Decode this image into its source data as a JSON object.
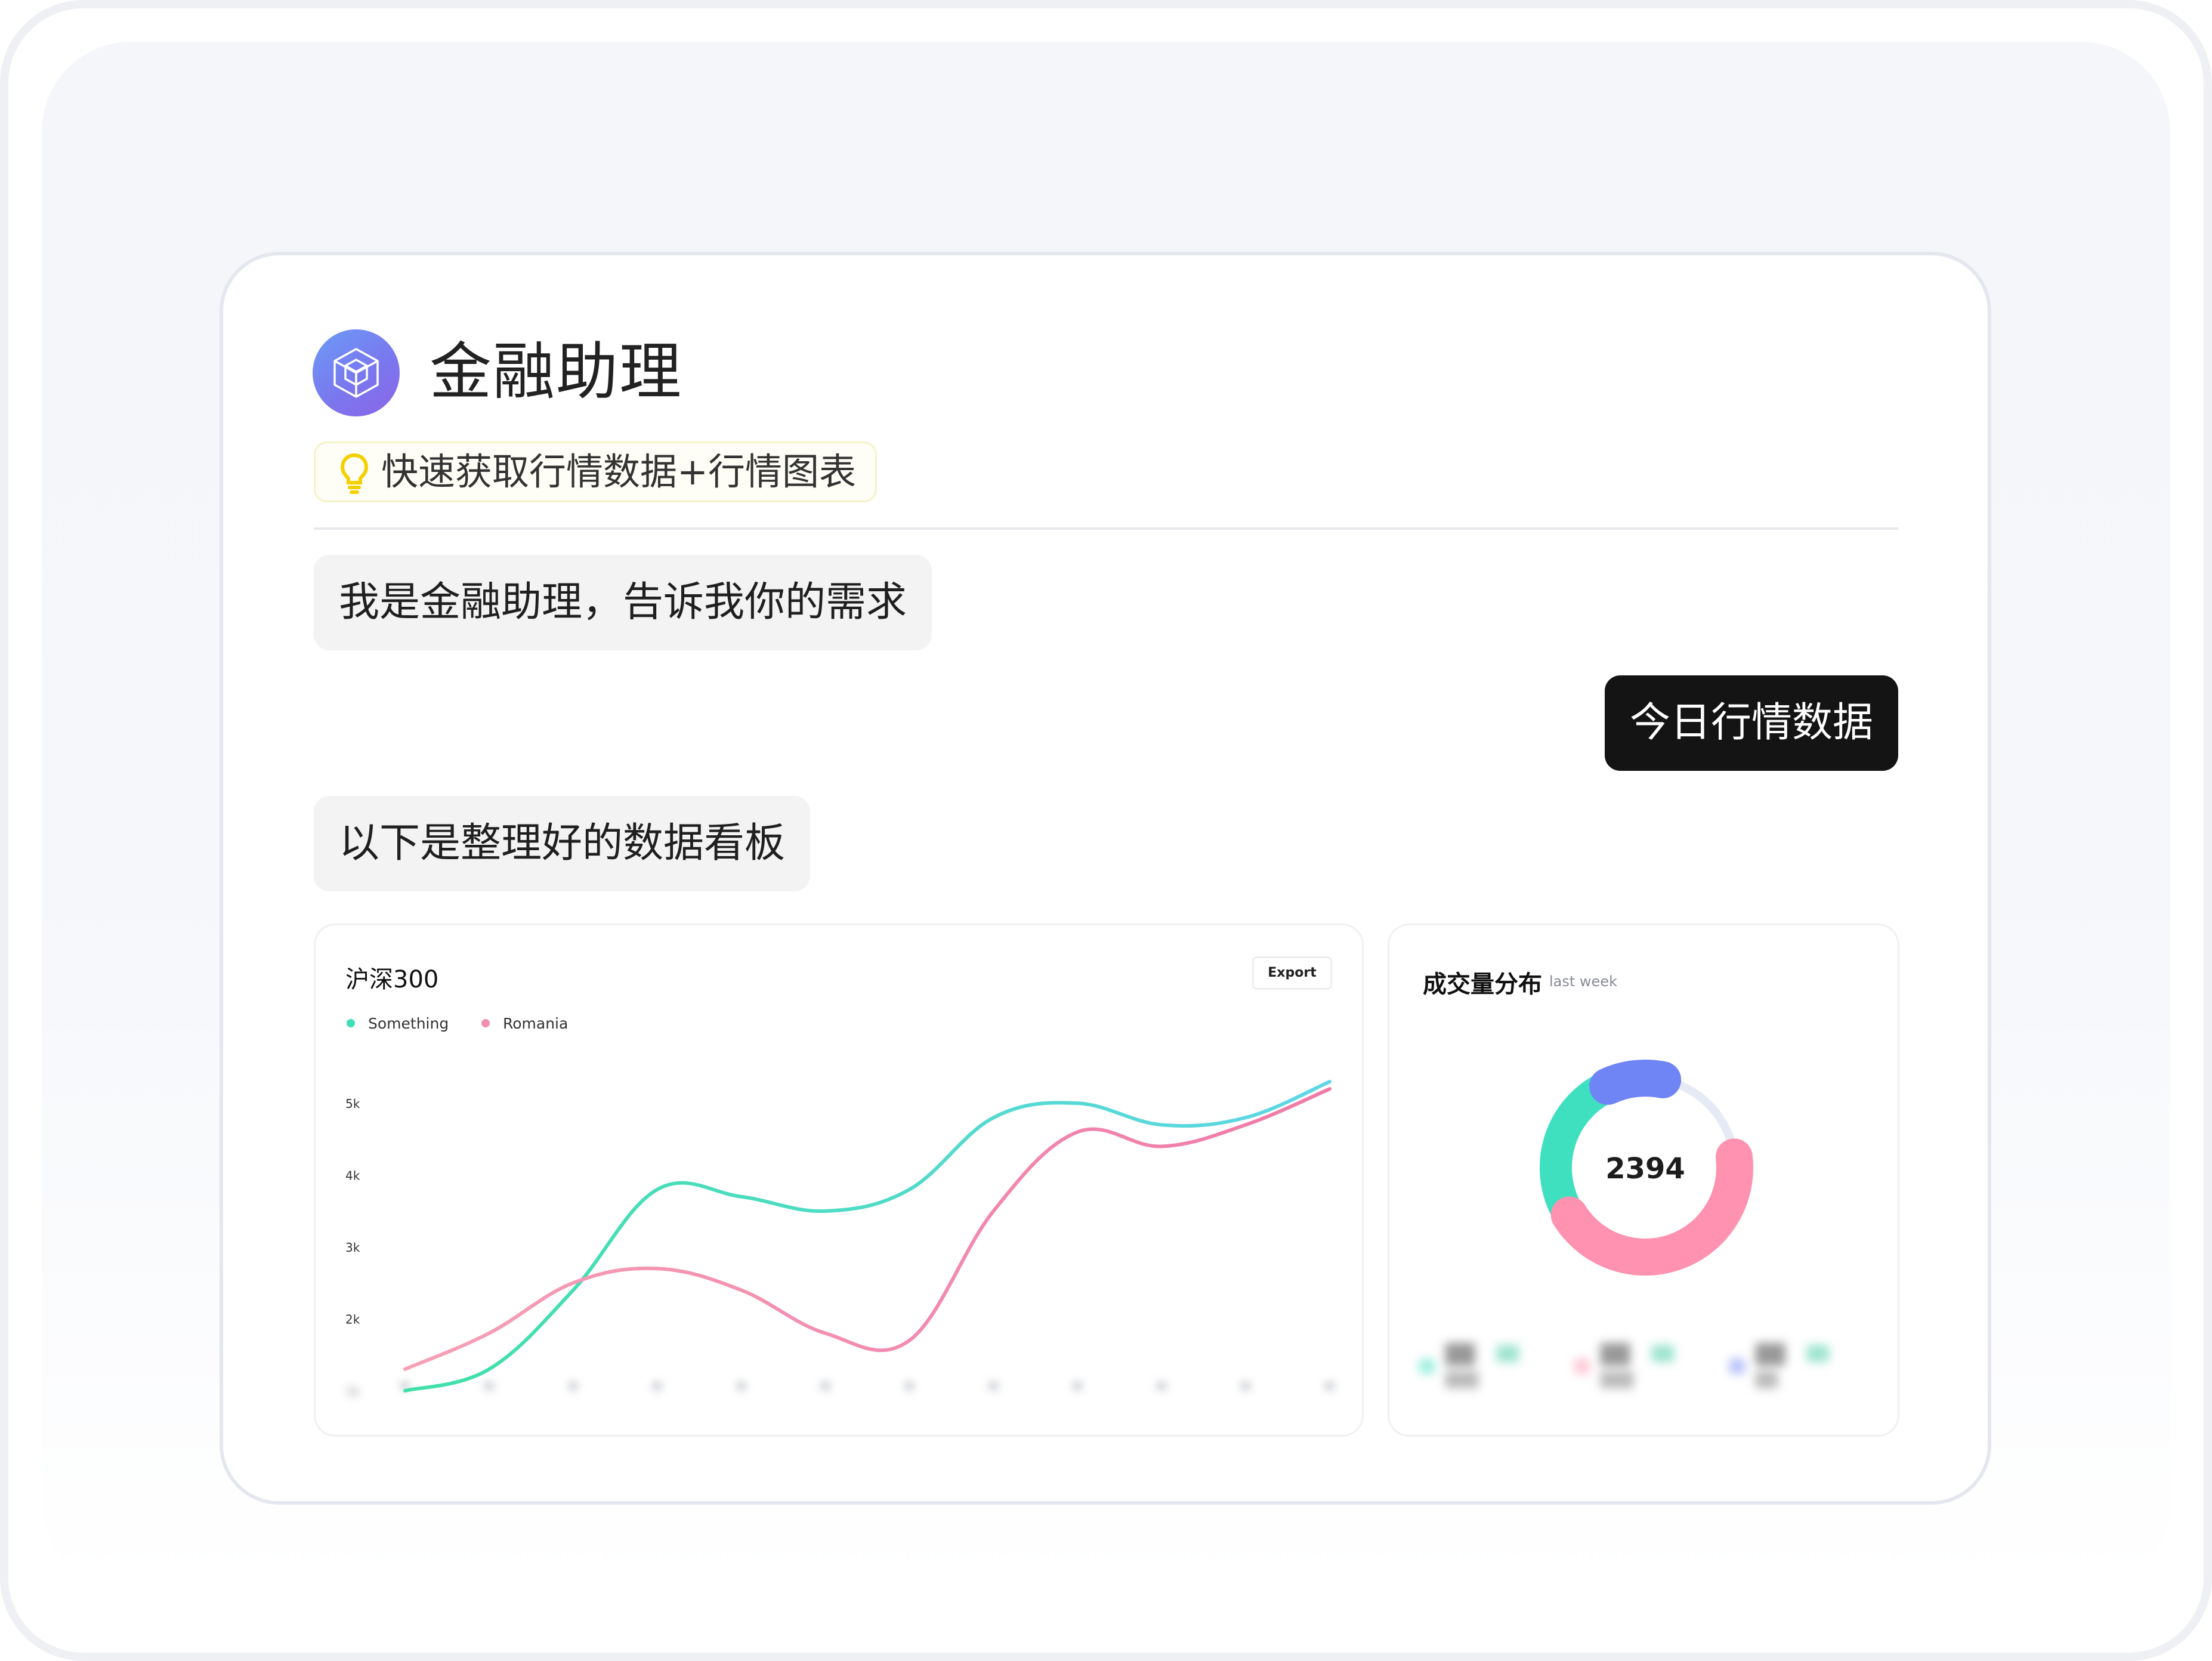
{
  "app": {
    "title": "金融助理",
    "hint": "快速获取行情数据+行情图表",
    "avatar_icon": "cube-icon",
    "hint_icon": "lightbulb-icon"
  },
  "chat": {
    "messages": [
      {
        "role": "assistant",
        "text": "我是金融助理，告诉我你的需求"
      },
      {
        "role": "user",
        "text": "今日行情数据"
      },
      {
        "role": "assistant",
        "text": "以下是整理好的数据看板"
      }
    ]
  },
  "line_panel": {
    "title": "沪深300",
    "export_label": "Export",
    "legend": [
      {
        "name": "Something",
        "color": "#3fe0b8"
      },
      {
        "name": "Romania",
        "color": "#f38fae"
      }
    ]
  },
  "donut_panel": {
    "title": "成交量分布",
    "subtitle": "last week",
    "center_value": "2394",
    "colors": [
      "#3fe0c0",
      "#6f84f5",
      "#ff92b0",
      "#e6eaf5"
    ]
  },
  "chart_data": [
    {
      "type": "line",
      "title": "沪深300",
      "x": [
        "",
        "",
        "",
        "",
        "",
        "",
        "",
        "",
        "",
        "",
        "",
        ""
      ],
      "series": [
        {
          "name": "Something",
          "values": [
            1000,
            1300,
            2400,
            3800,
            3700,
            3500,
            3800,
            4800,
            5000,
            4700,
            4800,
            5300
          ]
        },
        {
          "name": "Romania",
          "values": [
            1300,
            1800,
            2500,
            2700,
            2400,
            1800,
            1700,
            3500,
            4600,
            4400,
            4700,
            5200
          ]
        }
      ],
      "yticks": [
        "2k",
        "3k",
        "4k",
        "5k"
      ],
      "ylim": [
        1000,
        5400
      ],
      "legend": "top-left"
    },
    {
      "type": "pie",
      "title": "成交量分布",
      "subtitle": "last week",
      "center_label": "2394",
      "values": [
        27,
        10,
        43,
        20
      ]
    }
  ]
}
